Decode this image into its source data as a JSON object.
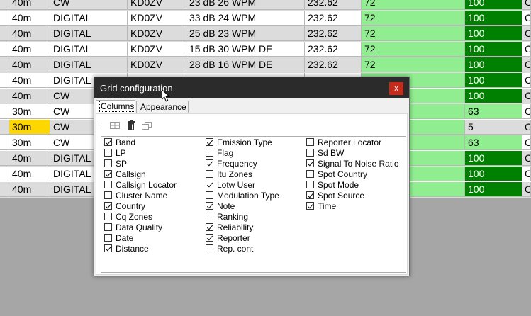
{
  "grid": {
    "rows": [
      {
        "band": "40m",
        "mode": "CW",
        "callsign": "KD0ZV",
        "snr_wpm": "23 dB  26 WPM",
        "freq": "232.62",
        "rel": "72",
        "pct": "100",
        "extra": "C",
        "bg": "#dcdcdc",
        "band_hl": false,
        "rel_style": "light",
        "pct_style": "dark"
      },
      {
        "band": "40m",
        "mode": "DIGITAL",
        "callsign": "KD0ZV",
        "snr_wpm": "33 dB  24 WPM",
        "freq": "232.62",
        "rel": "72",
        "pct": "100",
        "extra": "C",
        "bg": "#ffffff",
        "band_hl": false,
        "rel_style": "light",
        "pct_style": "dark"
      },
      {
        "band": "40m",
        "mode": "DIGITAL",
        "callsign": "KD0ZV",
        "snr_wpm": "25 dB  23 WPM",
        "freq": "232.62",
        "rel": "72",
        "pct": "100",
        "extra": "C",
        "bg": "#dcdcdc",
        "band_hl": false,
        "rel_style": "light",
        "pct_style": "dark"
      },
      {
        "band": "40m",
        "mode": "DIGITAL",
        "callsign": "KD0ZV",
        "snr_wpm": "15 dB  30 WPM   DE",
        "freq": "232.62",
        "rel": "72",
        "pct": "100",
        "extra": "C",
        "bg": "#ffffff",
        "band_hl": false,
        "rel_style": "light",
        "pct_style": "dark"
      },
      {
        "band": "40m",
        "mode": "DIGITAL",
        "callsign": "KD0ZV",
        "snr_wpm": "28 dB  16 WPM   DE",
        "freq": "232.62",
        "rel": "72",
        "pct": "100",
        "extra": "C",
        "bg": "#dcdcdc",
        "band_hl": false,
        "rel_style": "light",
        "pct_style": "dark"
      },
      {
        "band": "40m",
        "mode": "DIGITAL",
        "callsign": "",
        "snr_wpm": "",
        "freq": "",
        "rel": "",
        "pct": "100",
        "extra": "C",
        "bg": "#ffffff",
        "band_hl": false,
        "rel_style": "light",
        "pct_style": "dark"
      },
      {
        "band": "40m",
        "mode": "CW",
        "callsign": "",
        "snr_wpm": "",
        "freq": "",
        "rel": "",
        "pct": "100",
        "extra": "C",
        "bg": "#dcdcdc",
        "band_hl": false,
        "rel_style": "light",
        "pct_style": "dark"
      },
      {
        "band": "30m",
        "mode": "CW",
        "callsign": "",
        "snr_wpm": "",
        "freq": "",
        "rel": "",
        "pct": "63",
        "extra": "C",
        "bg": "#ffffff",
        "band_hl": false,
        "rel_style": "light",
        "pct_style": "light"
      },
      {
        "band": "30m",
        "mode": "CW",
        "callsign": "",
        "snr_wpm": "",
        "freq": "",
        "rel": "",
        "pct": "5",
        "extra": "C",
        "bg": "#dcdcdc",
        "band_hl": true,
        "rel_style": "light",
        "pct_style": "none"
      },
      {
        "band": "30m",
        "mode": "CW",
        "callsign": "",
        "snr_wpm": "",
        "freq": "",
        "rel": "",
        "pct": "63",
        "extra": "C",
        "bg": "#ffffff",
        "band_hl": false,
        "rel_style": "light",
        "pct_style": "light"
      },
      {
        "band": "40m",
        "mode": "DIGITAL",
        "callsign": "",
        "snr_wpm": "",
        "freq": "",
        "rel": "",
        "pct": "100",
        "extra": "C",
        "bg": "#dcdcdc",
        "band_hl": false,
        "rel_style": "light",
        "pct_style": "dark"
      },
      {
        "band": "40m",
        "mode": "DIGITAL",
        "callsign": "",
        "snr_wpm": "",
        "freq": "",
        "rel": "",
        "pct": "100",
        "extra": "C",
        "bg": "#ffffff",
        "band_hl": false,
        "rel_style": "light",
        "pct_style": "dark"
      },
      {
        "band": "40m",
        "mode": "DIGITAL",
        "callsign": "",
        "snr_wpm": "",
        "freq": "",
        "rel": "",
        "pct": "100",
        "extra": "C",
        "bg": "#dcdcdc",
        "band_hl": false,
        "rel_style": "light",
        "pct_style": "dark"
      }
    ]
  },
  "dialog": {
    "title": "Grid configuration",
    "close_label": "x",
    "tabs": [
      {
        "label": "Columns",
        "active": true
      },
      {
        "label": "Appearance",
        "active": false
      }
    ],
    "toolbar": {
      "icons": [
        "columns-layout-icon",
        "delete-icon",
        "copy-icon"
      ]
    },
    "columns": [
      [
        {
          "label": "Band",
          "checked": true
        },
        {
          "label": "LP",
          "checked": false
        },
        {
          "label": "SP",
          "checked": false
        },
        {
          "label": "Callsign",
          "checked": true
        },
        {
          "label": "Callsign Locator",
          "checked": false
        },
        {
          "label": "Cluster Name",
          "checked": false
        },
        {
          "label": "Country",
          "checked": true
        },
        {
          "label": "Cq Zones",
          "checked": false
        },
        {
          "label": "Data Quality",
          "checked": false
        },
        {
          "label": "Date",
          "checked": false
        },
        {
          "label": "Distance",
          "checked": true
        }
      ],
      [
        {
          "label": "Emission Type",
          "checked": true
        },
        {
          "label": "Flag",
          "checked": false
        },
        {
          "label": "Frequency",
          "checked": true
        },
        {
          "label": "Itu Zones",
          "checked": false
        },
        {
          "label": "Lotw User",
          "checked": true
        },
        {
          "label": "Modulation Type",
          "checked": false
        },
        {
          "label": "Note",
          "checked": true
        },
        {
          "label": "Ranking",
          "checked": false
        },
        {
          "label": "Reliability",
          "checked": true
        },
        {
          "label": "Reporter",
          "checked": true
        },
        {
          "label": "Rep. cont",
          "checked": false
        }
      ],
      [
        {
          "label": "Reporter Locator",
          "checked": false
        },
        {
          "label": "Sd BW",
          "checked": false
        },
        {
          "label": "Signal To Noise Ratio",
          "checked": true
        },
        {
          "label": "Spot Country",
          "checked": false
        },
        {
          "label": "Spot Mode",
          "checked": false
        },
        {
          "label": "Spot Source",
          "checked": true
        },
        {
          "label": "Time",
          "checked": true
        }
      ]
    ]
  }
}
